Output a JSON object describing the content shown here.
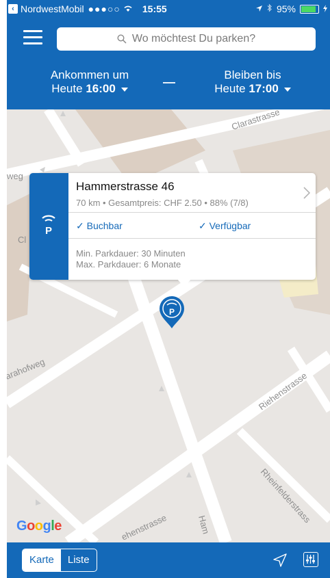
{
  "status_bar": {
    "carrier": "NordwestMobil",
    "signal": "●●●○○",
    "time": "15:55",
    "battery": "95%",
    "battery_level": 0.95
  },
  "header": {
    "search_placeholder": "Wo möchtest Du parken?",
    "arrive": {
      "label": "Ankommen um",
      "day": "Heute",
      "time": "16:00"
    },
    "stay": {
      "label": "Bleiben bis",
      "day": "Heute",
      "time": "17:00"
    },
    "separator": "—"
  },
  "map": {
    "streets": [
      "Clarastrasse",
      "Kasernenweg",
      "Clarahofweg",
      "Riehenstrasse",
      "Rheinfelderstrasse",
      "Riehenstrasse",
      "Hammerstrasse"
    ],
    "street_labels": {
      "clarastrasse": "Clarastrasse",
      "weg": "weg",
      "clarahofweg": "arahofweg",
      "riehenstrasse": "Riehenstrasse",
      "rheinfelder": "Rheinfelderstrass",
      "riehen_bottom": "ehenstrasse",
      "hammer": "Ham",
      "cl": "Cl"
    },
    "google_logo": "Google"
  },
  "parking": {
    "title": "Hammerstrasse 46",
    "details": "70 km • Gesamtpreis: CHF 2.50 • 88% (7/8)",
    "bookable": "✓ Buchbar",
    "available": "✓ Verfügbar",
    "min_duration": "Min. Parkdauer: 30 Minuten",
    "max_duration": "Max. Parkdauer: 6 Monate"
  },
  "bottom_bar": {
    "tab_map": "Karte",
    "tab_list": "Liste",
    "active_tab": "Karte"
  },
  "colors": {
    "brand": "#1469b8",
    "map_bg": "#e9e6e3",
    "building": "#dccfc3"
  }
}
